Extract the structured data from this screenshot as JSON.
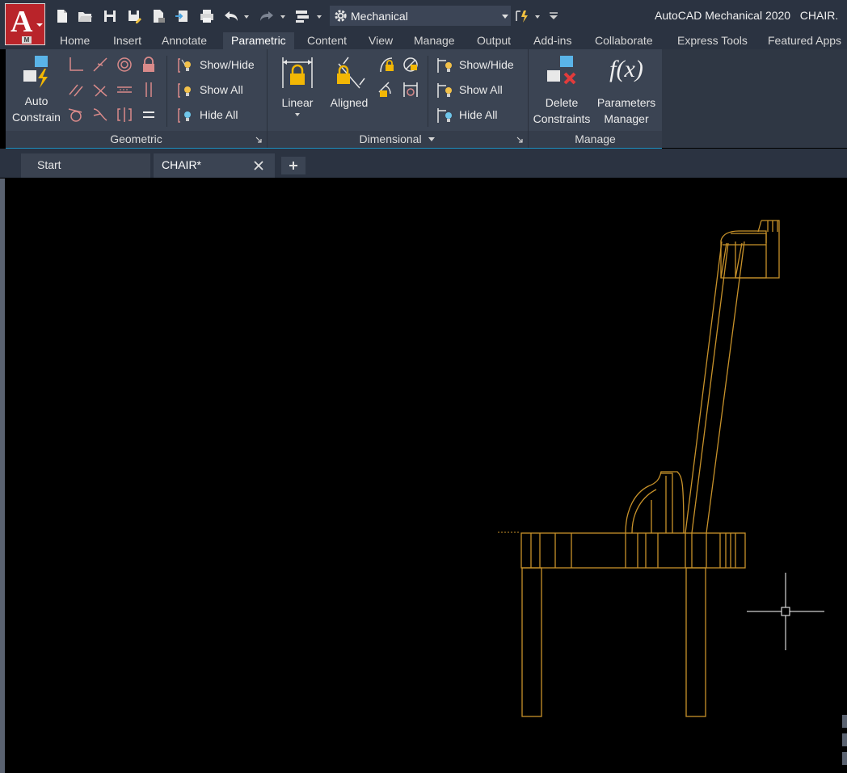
{
  "app": {
    "title": "AutoCAD Mechanical 2020",
    "file": "CHAIR.",
    "button_letter": "A",
    "button_badge": "M"
  },
  "quick_access": {
    "workspace": "Mechanical"
  },
  "tabs": [
    {
      "label": "Home",
      "active": false
    },
    {
      "label": "Insert",
      "active": false
    },
    {
      "label": "Annotate",
      "active": false
    },
    {
      "label": "Parametric",
      "active": true
    },
    {
      "label": "Content",
      "active": false
    },
    {
      "label": "View",
      "active": false
    },
    {
      "label": "Manage",
      "active": false
    },
    {
      "label": "Output",
      "active": false
    },
    {
      "label": "Add-ins",
      "active": false
    },
    {
      "label": "Collaborate",
      "active": false
    },
    {
      "label": "Express Tools",
      "active": false
    },
    {
      "label": "Featured Apps",
      "active": false
    }
  ],
  "ribbon": {
    "geometric": {
      "title": "Geometric",
      "auto_constrain": [
        "Auto",
        "Constrain"
      ],
      "show_hide": "Show/Hide",
      "show_all": "Show All",
      "hide_all": "Hide All"
    },
    "dimensional": {
      "title": "Dimensional",
      "linear": "Linear",
      "aligned": "Aligned",
      "show_hide": "Show/Hide",
      "show_all": "Show All",
      "hide_all": "Hide All"
    },
    "manage": {
      "title": "Manage",
      "delete_constraints": [
        "Delete",
        "Constraints"
      ],
      "parameters_manager": [
        "Parameters",
        "Manager"
      ],
      "fx": "f(x)"
    }
  },
  "document_tabs": [
    {
      "label": "Start",
      "active": false
    },
    {
      "label": "CHAIR*",
      "active": true
    }
  ],
  "colors": {
    "drawing": "#c8922a",
    "ribbon": "#3b4453",
    "title": "#2b3341",
    "accent": "#1c8fbf"
  }
}
